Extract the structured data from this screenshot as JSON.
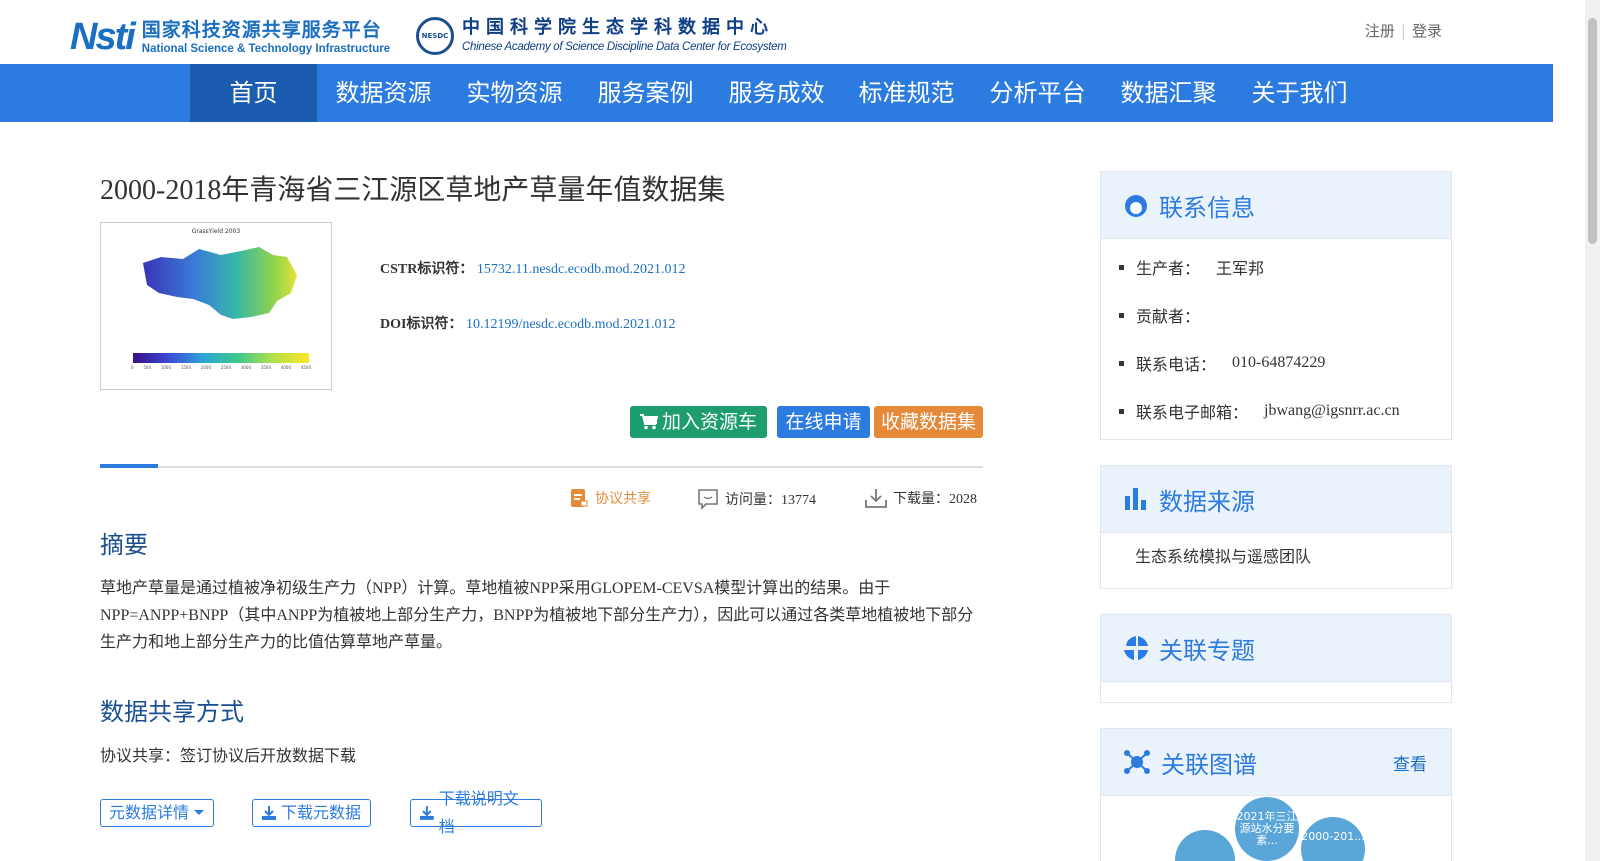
{
  "header": {
    "nsti_mark": "Nsti",
    "nsti_cn": "国家科技资源共享服务平台",
    "nsti_en": "National Science & Technology Infrastructure",
    "nesdc_badge": "NESDC",
    "nesdc_cn": "中国科学院生态学科数据中心",
    "nesdc_en": "Chinese Academy of Science Discipline Data Center for Ecosystem",
    "register": "注册",
    "login": "登录"
  },
  "nav": {
    "items": [
      "首页",
      "数据资源",
      "实物资源",
      "服务案例",
      "服务成效",
      "标准规范",
      "分析平台",
      "数据汇聚",
      "关于我们"
    ],
    "active": "首页"
  },
  "dataset": {
    "title": "2000-2018年青海省三江源区草地产草量年值数据集",
    "thumb_title": "GrassYield 2003",
    "thumb_ticks": [
      "0",
      "500",
      "1000",
      "1500",
      "2000",
      "2500",
      "3000",
      "3500",
      "4000",
      "4500"
    ],
    "cstr_label": "CSTR标识符：",
    "cstr_value": "15732.11.nesdc.ecodb.mod.2021.012",
    "doi_label": "DOI标识符：",
    "doi_value": "10.12199/nesdc.ecodb.mod.2021.012"
  },
  "actions": {
    "cart": "加入资源车",
    "apply": "在线申请",
    "favorite": "收藏数据集"
  },
  "stats": {
    "share_mode": "协议共享",
    "visits": "访问量：13774",
    "downloads": "下载量：2028"
  },
  "abstract": {
    "heading": "摘要",
    "text": "草地产草量是通过植被净初级生产力（NPP）计算。草地植被NPP采用GLOPEM-CEVSA模型计算出的结果。由于NPP=ANPP+BNPP（其中ANPP为植被地上部分生产力，BNPP为植被地下部分生产力），因此可以通过各类草地植被地下部分生产力和地上部分生产力的比值估算草地产草量。"
  },
  "sharing": {
    "heading": "数据共享方式",
    "text": "协议共享：签订协议后开放数据下载"
  },
  "buttons": {
    "metadata_detail": "元数据详情",
    "download_metadata": "下载元数据",
    "download_doc": "下载说明文档"
  },
  "sidebar": {
    "contact": {
      "title": "联系信息",
      "items": [
        {
          "label": "生产者：",
          "value": "王军邦"
        },
        {
          "label": "贡献者：",
          "value": ""
        },
        {
          "label": "联系电话：",
          "value": "010-64874229"
        },
        {
          "label": "联系电子邮箱：",
          "value": "jbwang@igsnrr.ac.cn"
        }
      ]
    },
    "source": {
      "title": "数据来源",
      "text": "生态系统模拟与遥感团队"
    },
    "topics": {
      "title": "关联专题"
    },
    "graph": {
      "title": "关联图谱",
      "more": "查看",
      "bubbles": [
        "2021年三江源站水分要素...",
        "2000-201..."
      ]
    }
  },
  "colors": {
    "nav_bg": "#2c7be0",
    "nav_active": "#1b5cb0",
    "cart_btn": "#1e9d6e",
    "apply_btn": "#2c7be0",
    "fav_btn": "#e68a3a",
    "heading": "#1a4f8f",
    "link": "#1a6fc2"
  }
}
